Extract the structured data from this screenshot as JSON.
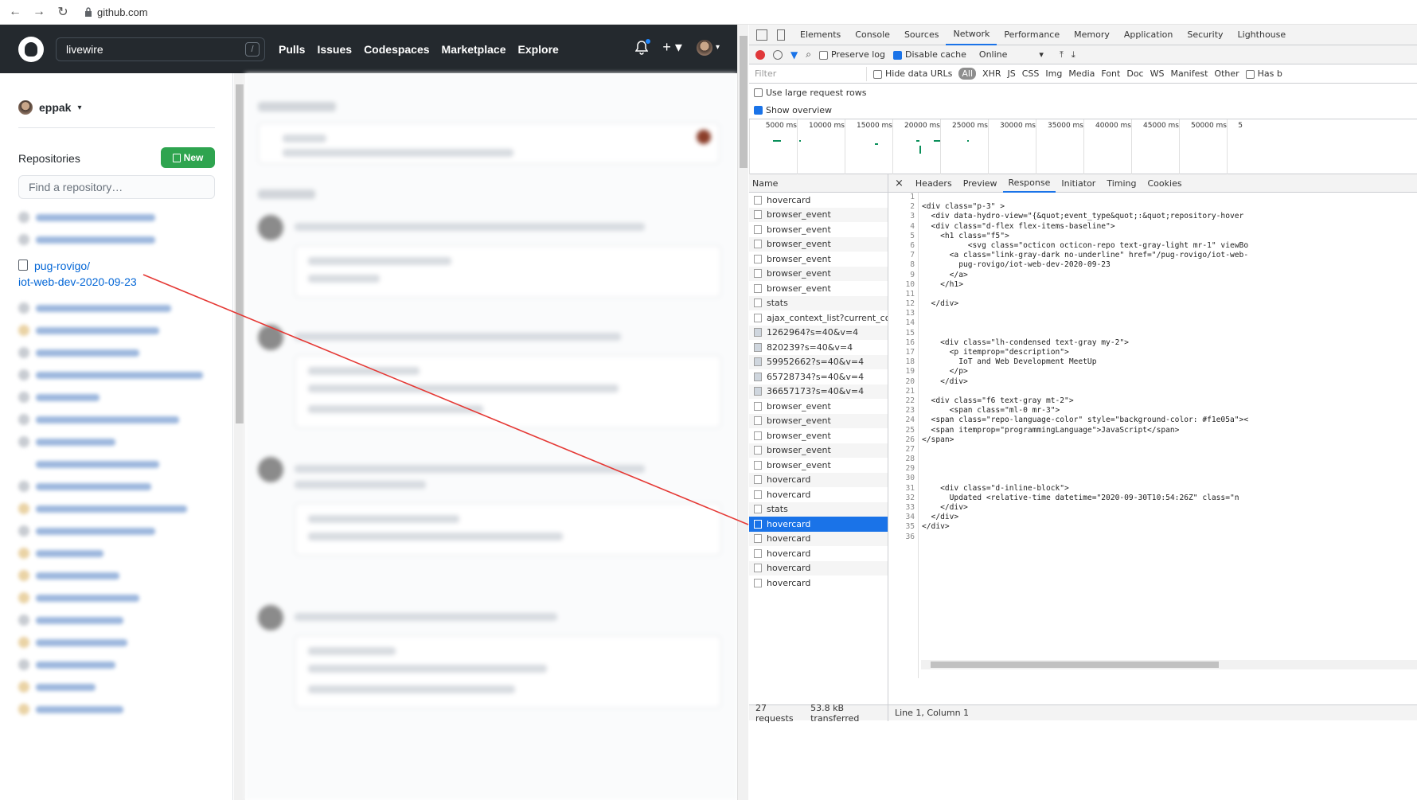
{
  "browser": {
    "url": "github.com"
  },
  "github": {
    "search_value": "livewire",
    "search_hint": "/",
    "nav": [
      "Pulls",
      "Issues",
      "Codespaces",
      "Marketplace",
      "Explore"
    ],
    "user": "eppak",
    "repositories_title": "Repositories",
    "new_button": "New",
    "find_placeholder": "Find a repository…",
    "highlighted_repo_line1": "pug-rovigo/",
    "highlighted_repo_line2": "iot-web-dev-2020-09-23"
  },
  "devtools": {
    "tabs": [
      "Elements",
      "Console",
      "Sources",
      "Network",
      "Performance",
      "Memory",
      "Application",
      "Security",
      "Lighthouse"
    ],
    "active_tab": "Network",
    "toolbar": {
      "preserve_log": "Preserve log",
      "disable_cache": "Disable cache",
      "throttle": "Online"
    },
    "filter": {
      "placeholder": "Filter",
      "hide_data_urls": "Hide data URLs",
      "types": [
        "All",
        "XHR",
        "JS",
        "CSS",
        "Img",
        "Media",
        "Font",
        "Doc",
        "WS",
        "Manifest",
        "Other"
      ],
      "has_blocked": "Has b"
    },
    "options": {
      "large_rows": "Use large request rows",
      "show_overview": "Show overview"
    },
    "overview_ticks": [
      "5000 ms",
      "10000 ms",
      "15000 ms",
      "20000 ms",
      "25000 ms",
      "30000 ms",
      "35000 ms",
      "40000 ms",
      "45000 ms",
      "50000 ms",
      "5"
    ],
    "name_header": "Name",
    "requests": [
      "hovercard",
      "browser_event",
      "browser_event",
      "browser_event",
      "browser_event",
      "browser_event",
      "browser_event",
      "stats",
      "ajax_context_list?current_cont...",
      "1262964?s=40&v=4",
      "820239?s=40&v=4",
      "59952662?s=40&v=4",
      "65728734?s=40&v=4",
      "36657173?s=40&v=4",
      "browser_event",
      "browser_event",
      "browser_event",
      "browser_event",
      "browser_event",
      "hovercard",
      "hovercard",
      "stats",
      "hovercard",
      "hovercard",
      "hovercard",
      "hovercard",
      "hovercard"
    ],
    "selected_index": 22,
    "detail_tabs": [
      "Headers",
      "Preview",
      "Response",
      "Initiator",
      "Timing",
      "Cookies"
    ],
    "active_detail_tab": "Response",
    "code_lines": [
      "",
      "<div class=\"p-3\" >",
      "  <div data-hydro-view=\"{&quot;event_type&quot;:&quot;repository-hover",
      "  <div class=\"d-flex flex-items-baseline\">",
      "    <h1 class=\"f5\">",
      "          <svg class=\"octicon octicon-repo text-gray-light mr-1\" viewBo",
      "      <a class=\"link-gray-dark no-underline\" href=\"/pug-rovigo/iot-web-",
      "        pug-rovigo/iot-web-dev-2020-09-23",
      "      </a>",
      "    </h1>",
      "",
      "  </div>",
      "",
      "",
      "",
      "    <div class=\"lh-condensed text-gray my-2\">",
      "      <p itemprop=\"description\">",
      "        IoT and Web Development MeetUp",
      "      </p>",
      "    </div>",
      "",
      "  <div class=\"f6 text-gray mt-2\">",
      "      <span class=\"ml-0 mr-3\">",
      "  <span class=\"repo-language-color\" style=\"background-color: #f1e05a\"><",
      "  <span itemprop=\"programmingLanguage\">JavaScript</span>",
      "</span>",
      "",
      "",
      "",
      "",
      "    <div class=\"d-inline-block\">",
      "      Updated <relative-time datetime=\"2020-09-30T10:54:26Z\" class=\"n",
      "    </div>",
      "  </div>",
      "</div>",
      ""
    ],
    "status": {
      "requests": "27 requests",
      "transferred": "53.8 kB transferred",
      "cursor": "Line 1, Column 1"
    }
  }
}
